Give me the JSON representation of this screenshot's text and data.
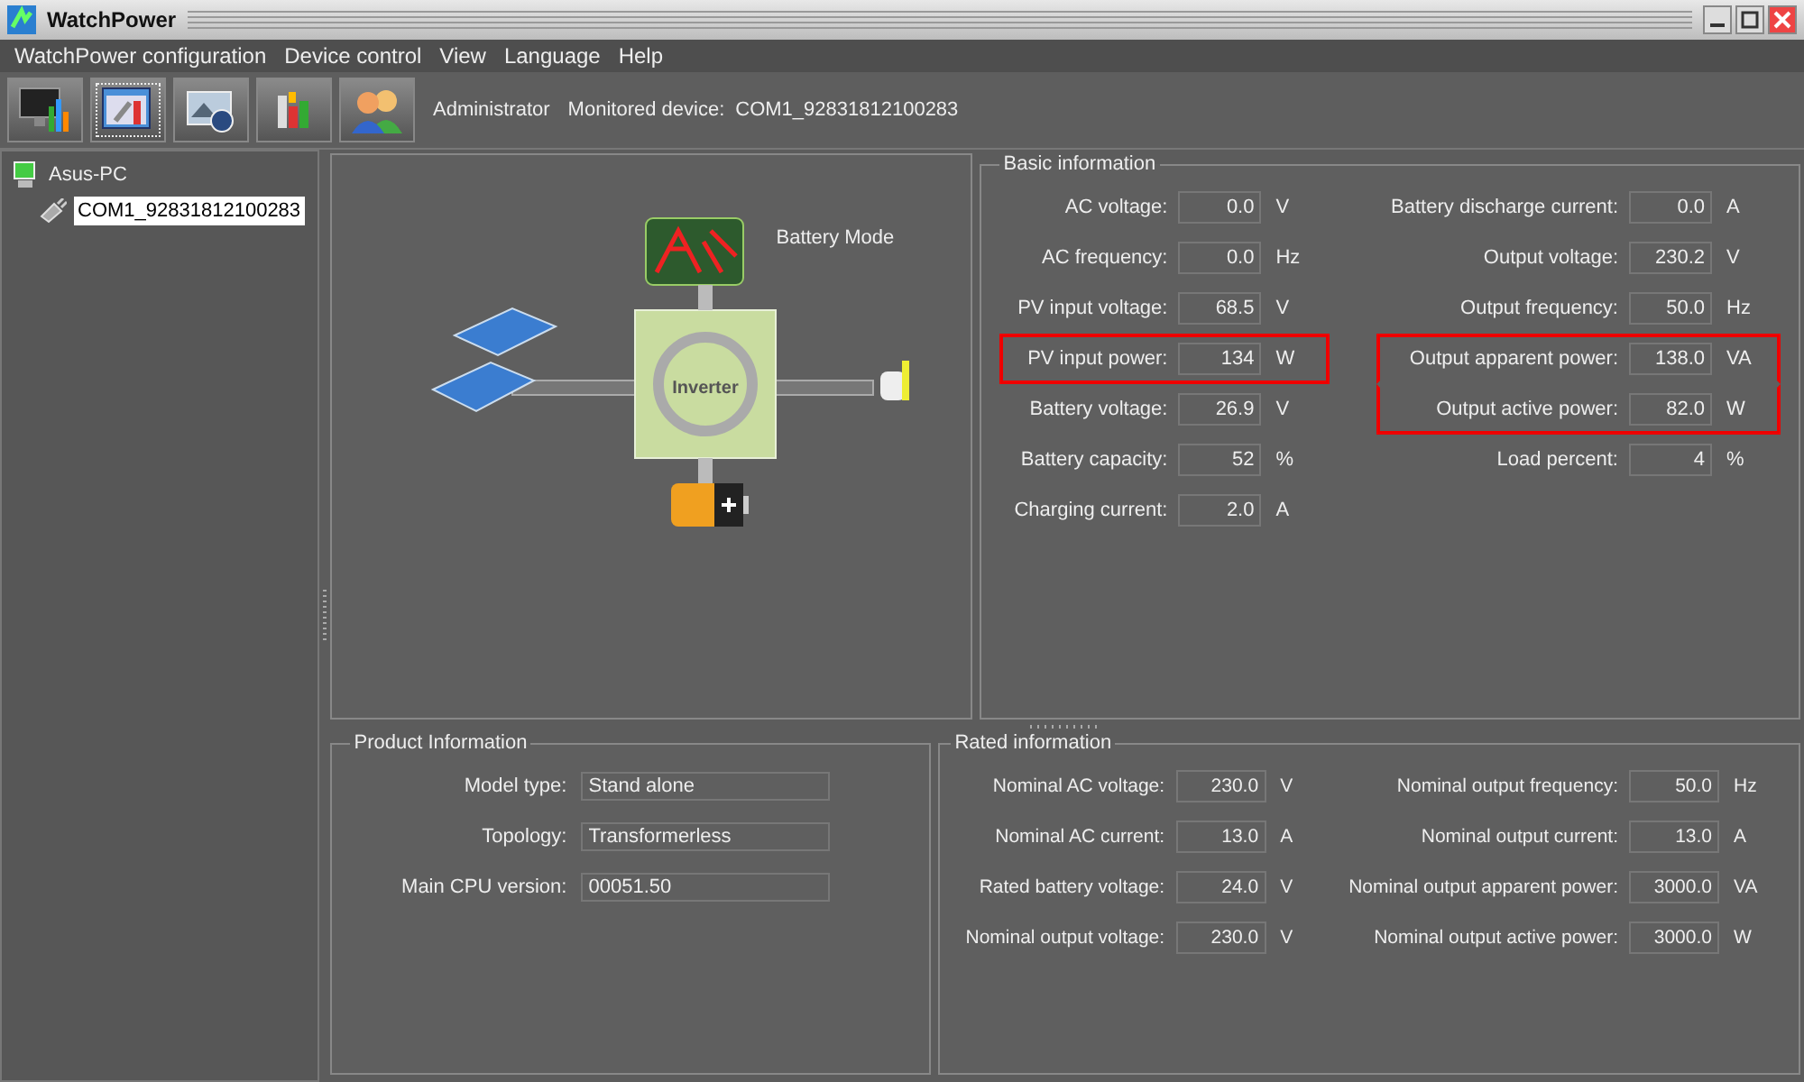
{
  "window": {
    "title": "WatchPower"
  },
  "menu": [
    "WatchPower configuration",
    "Device control",
    "View",
    "Language",
    "Help"
  ],
  "toolbar": {
    "user": "Administrator",
    "device_label": "Monitored device:",
    "device": "COM1_92831812100283"
  },
  "tree": [
    {
      "label": "Asus-PC",
      "children": [
        {
          "label": "COM1_92831812100283",
          "selected": true
        }
      ]
    }
  ],
  "diagram": {
    "mode": "Battery Mode",
    "inverter_label": "Inverter"
  },
  "basic_information": {
    "title": "Basic information",
    "columns": [
      [
        {
          "label": "AC voltage:",
          "value": "0.0",
          "unit": "V",
          "highlighted": false
        },
        {
          "label": "AC frequency:",
          "value": "0.0",
          "unit": "Hz",
          "highlighted": false
        },
        {
          "label": "PV input voltage:",
          "value": "68.5",
          "unit": "V",
          "highlighted": false
        },
        {
          "label": "PV input power:",
          "value": "134",
          "unit": "W",
          "highlighted": true
        },
        {
          "label": "Battery voltage:",
          "value": "26.9",
          "unit": "V",
          "highlighted": false
        },
        {
          "label": "Battery capacity:",
          "value": "52",
          "unit": "%",
          "highlighted": false
        },
        {
          "label": "Charging current:",
          "value": "2.0",
          "unit": "A",
          "highlighted": false
        }
      ],
      [
        {
          "label": "Battery discharge current:",
          "value": "0.0",
          "unit": "A",
          "highlighted": false
        },
        {
          "label": "Output voltage:",
          "value": "230.2",
          "unit": "V",
          "highlighted": false
        },
        {
          "label": "Output frequency:",
          "value": "50.0",
          "unit": "Hz",
          "highlighted": false
        },
        {
          "label": "Output apparent power:",
          "value": "138.0",
          "unit": "VA",
          "highlighted": true
        },
        {
          "label": "Output active power:",
          "value": "82.0",
          "unit": "W",
          "highlighted": true
        },
        {
          "label": "Load percent:",
          "value": "4",
          "unit": "%",
          "highlighted": false
        }
      ]
    ]
  },
  "product_information": {
    "title": "Product Information",
    "rows": [
      {
        "label": "Model type:",
        "value": "Stand alone"
      },
      {
        "label": "Topology:",
        "value": "Transformerless"
      },
      {
        "label": "Main CPU version:",
        "value": "00051.50"
      }
    ]
  },
  "rated_information": {
    "title": "Rated information",
    "columns": [
      [
        {
          "label": "Nominal AC voltage:",
          "value": "230.0",
          "unit": "V"
        },
        {
          "label": "Nominal AC current:",
          "value": "13.0",
          "unit": "A"
        },
        {
          "label": "Rated battery voltage:",
          "value": "24.0",
          "unit": "V"
        },
        {
          "label": "Nominal output voltage:",
          "value": "230.0",
          "unit": "V"
        }
      ],
      [
        {
          "label": "Nominal output frequency:",
          "value": "50.0",
          "unit": "Hz"
        },
        {
          "label": "Nominal output current:",
          "value": "13.0",
          "unit": "A"
        },
        {
          "label": "Nominal output apparent power:",
          "value": "3000.0",
          "unit": "VA"
        },
        {
          "label": "Nominal output active power:",
          "value": "3000.0",
          "unit": "W"
        }
      ]
    ]
  }
}
